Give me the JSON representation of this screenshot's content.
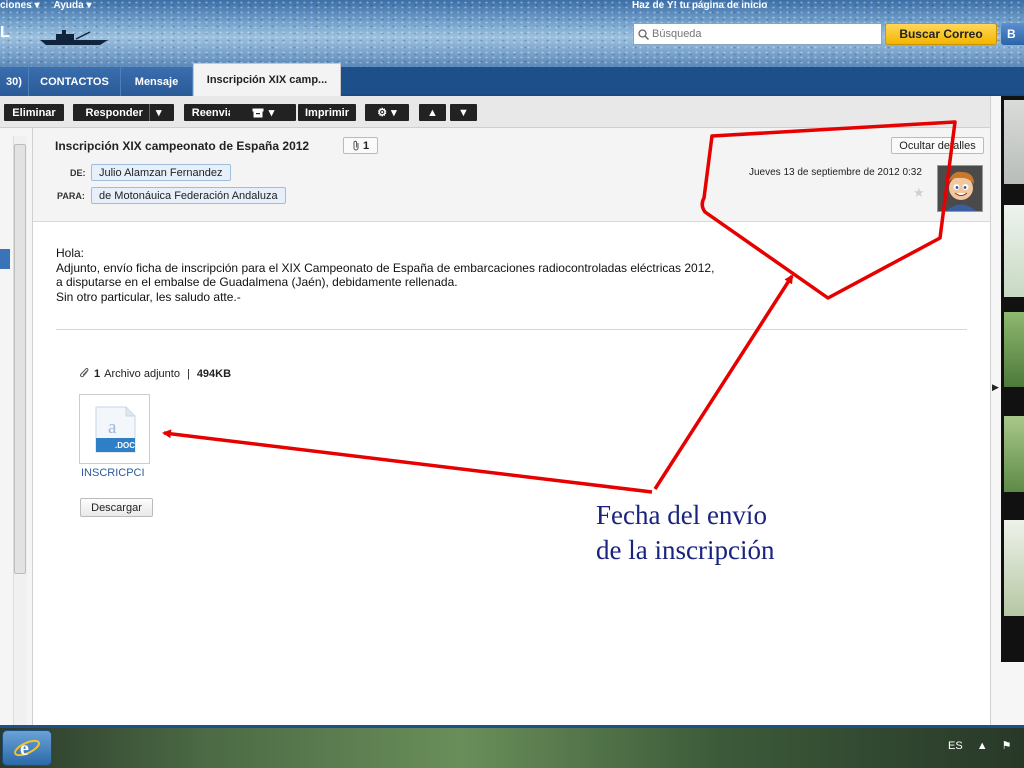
{
  "header": {
    "top_menu": [
      "ciones ▾",
      "Ayuda ▾"
    ],
    "home_hint": "Haz de Y! tu página de inicio",
    "logo_fragment": "L",
    "search_placeholder": "Búsqueda",
    "search_button": "Buscar Correo",
    "search_button2": "B"
  },
  "tabs": [
    {
      "label": "30)"
    },
    {
      "label": "CONTACTOS"
    },
    {
      "label": "Mensaje"
    },
    {
      "label": "Inscripción XIX camp..."
    }
  ],
  "toolbar": {
    "delete": "Eliminar",
    "reply": "Responder",
    "forward": "Reenviar",
    "print": "Imprimir"
  },
  "message": {
    "subject": "Inscripción XIX campeonato de España 2012",
    "attachment_count": "1",
    "from_label": "DE:",
    "from": "Julio Alamzan Fernandez",
    "to_label": "PARA:",
    "to": "de Motonáuica Federación Andaluza",
    "hide_details": "Ocultar detalles",
    "date": "Jueves 13 de septiembre de 2012 0:32",
    "body": [
      "Hola:",
      "Adjunto, envío ficha de inscripción para el XIX Campeonato de España de embarcaciones radiocontroladas eléctricas 2012,",
      "a disputarse en el embalse de Guadalmena (Jaén), debidamente rellenada.",
      "Sin otro particular, les saludo atte.-"
    ]
  },
  "attachments": {
    "count": "1",
    "label": "Archivo adjunto",
    "separator": "|",
    "size": "494KB",
    "file_name": "INSCRICPCI",
    "file_ext": ".DOC",
    "download": "Descargar"
  },
  "annotation": {
    "line1": "Fecha del envío",
    "line2": "de la inscripción",
    "color": "#e60000"
  },
  "taskbar": {
    "language": "ES"
  }
}
